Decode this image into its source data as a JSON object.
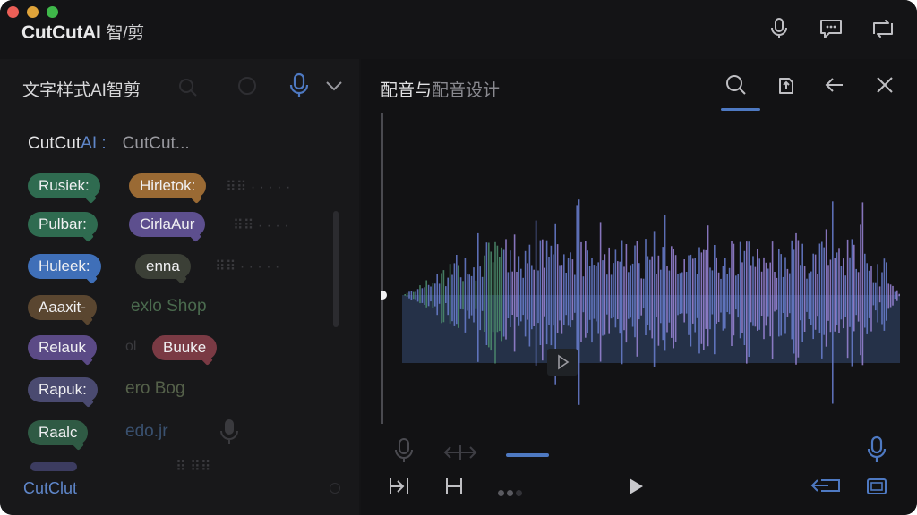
{
  "window": {
    "app_title": "CutCutAI",
    "app_subtitle": "智/剪"
  },
  "titlebar_icons": [
    "microphone-icon",
    "chat-icon",
    "sync-icon"
  ],
  "left_panel": {
    "header_title": "文字样式AI智剪",
    "section_prefix": "CutCut",
    "section_accent": "AI :",
    "section_dim": "CutCut...",
    "tags": [
      {
        "label": "Rusiek:",
        "color": "#2f6b50"
      },
      {
        "label": "Hirletok:",
        "color": "#9a6a34"
      },
      {
        "label": "Pulbar:",
        "color": "#2f6b50"
      },
      {
        "label": "CirlaAur",
        "color": "#5d4f8e"
      },
      {
        "label": "Huleek:",
        "color": "#3f6fb8"
      },
      {
        "label": "enna",
        "color": "#3b3f36"
      },
      {
        "label": "Aaaxit-",
        "color": "#5a4630"
      },
      {
        "label": "Relauk",
        "color": "#5b4a86"
      },
      {
        "label": "Buuke",
        "color": "#7a3a44"
      },
      {
        "label": "Rapuk:",
        "color": "#4a4a70"
      },
      {
        "label": "Raalc",
        "color": "#2f5a44"
      }
    ],
    "plain_words": [
      {
        "label": "exlo Shop",
        "color": "#4a6a4e"
      },
      {
        "label": "ero Bog",
        "color": "#55614a"
      },
      {
        "label": "edo.jr",
        "color": "#3a5170"
      }
    ],
    "footer_brand": "CutClut"
  },
  "right_panel": {
    "title_main": "配音与",
    "title_dim": "配音设计",
    "header_icons": [
      "search-icon",
      "export-icon",
      "back-arrow-icon",
      "close-icon"
    ]
  },
  "colors": {
    "accent": "#4e79c2",
    "waveform_green": "#4d8f6e",
    "waveform_blue": "#6a7fd0",
    "waveform_purple": "#9b86d8"
  }
}
